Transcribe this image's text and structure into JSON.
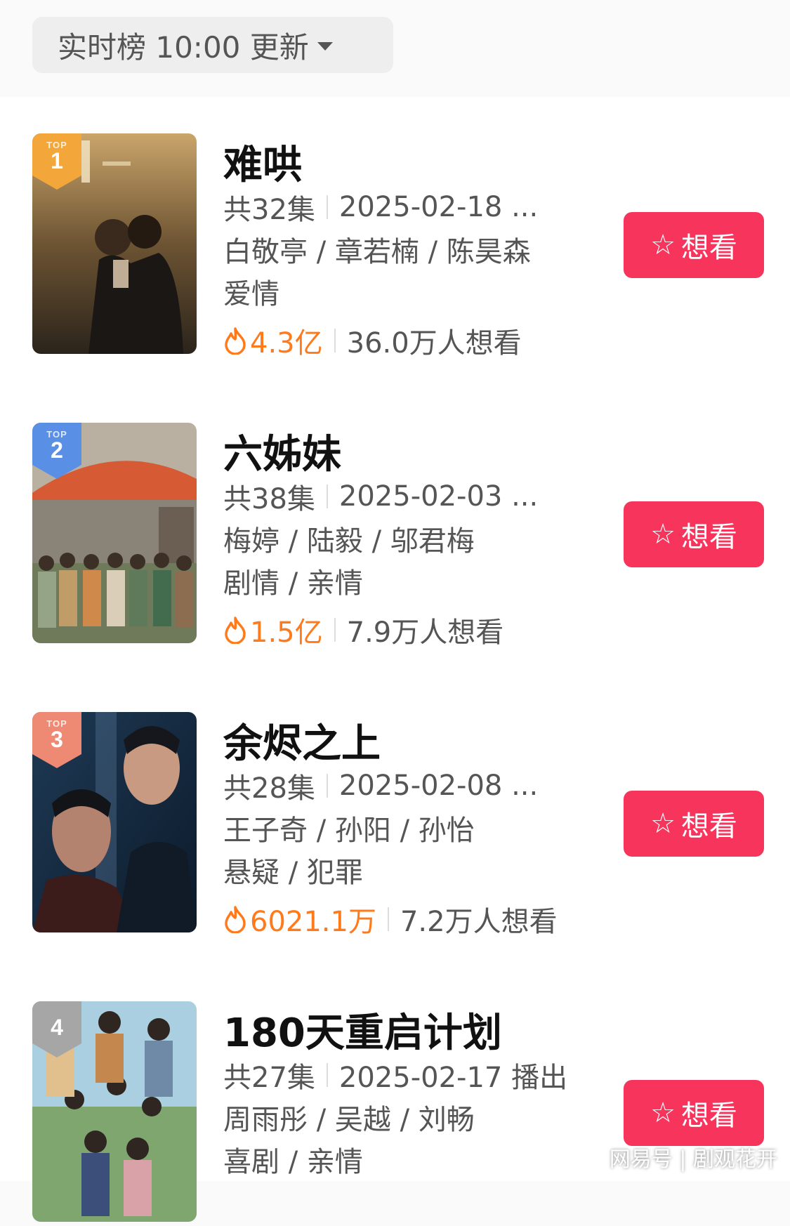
{
  "header": {
    "label": "实时榜 10:00 更新",
    "dropdown_icon": "caret-down-icon"
  },
  "items": [
    {
      "rank": "1",
      "badge_top": "TOP",
      "badge_color": "#f3a73a",
      "title": "难哄",
      "episodes": "共32集",
      "date": "2025-02-18 ...",
      "cast": "白敬亭 / 章若楠 / 陈昊森",
      "genre": "爱情",
      "heat": "4.3亿",
      "wants": "36.0万人想看",
      "button": "想看"
    },
    {
      "rank": "2",
      "badge_top": "TOP",
      "badge_color": "#5a8fe6",
      "title": "六姊妹",
      "episodes": "共38集",
      "date": "2025-02-03 ...",
      "cast": "梅婷 / 陆毅 / 邬君梅",
      "genre": "剧情 / 亲情",
      "heat": "1.5亿",
      "wants": "7.9万人想看",
      "button": "想看"
    },
    {
      "rank": "3",
      "badge_top": "TOP",
      "badge_color": "#ee8a74",
      "title": "余烬之上",
      "episodes": "共28集",
      "date": "2025-02-08 ...",
      "cast": "王子奇 / 孙阳 / 孙怡",
      "genre": "悬疑 / 犯罪",
      "heat": "6021.1万",
      "wants": "7.2万人想看",
      "button": "想看"
    },
    {
      "rank": "4",
      "badge_top": "",
      "badge_color": "#a6a6a6",
      "title": "180天重启计划",
      "episodes": "共27集",
      "date": "2025-02-17 播出",
      "cast": "周雨彤 / 吴越 / 刘畅",
      "genre": "喜剧 / 亲情",
      "heat": "",
      "wants": "",
      "button": "想看"
    }
  ],
  "watermark": "网易号 | 剧观花开",
  "colors": {
    "accent": "#f7345c",
    "heat": "#ff7a1a"
  },
  "icons": {
    "flame": "flame-icon",
    "star": "star-icon"
  }
}
